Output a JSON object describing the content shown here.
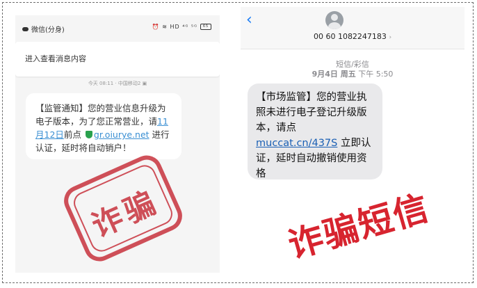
{
  "left": {
    "status": {
      "app": "微信(分身)",
      "icons": "⏰ ≋ HD ⁴ᴳ ⁵ᴳ",
      "battery": "65"
    },
    "notice": "进入查看消息内容",
    "time_line": "今天 08:11 · 中国移动2 ▣",
    "message": {
      "part1": "【监管通知】您的营业信息升级为电子版本，为了您正常营业，请",
      "date_link": "11月12日",
      "part2": "前点",
      "url": "gr.oiurye.net",
      "part3": " 进行认证，延时将自动销户！"
    },
    "stamp_text": "诈骗"
  },
  "right": {
    "back_icon": "‹",
    "sender": "00 60 1082247183",
    "sender_chevron": "›",
    "type": "短信/彩信",
    "date_bold": "9月4日 周五",
    "date_time": " 下午 5:50",
    "message": {
      "part1": "【市场监管】您的营业执照未进行电子登记升级版本，请点",
      "url": "muccat.cn/437S",
      "part2": " 立即认证，延时自动撤销使用资格"
    },
    "caption": "诈骗短信"
  },
  "colors": {
    "stamp_red": "#c62b36",
    "caption_red": "#d7242f",
    "ios_blue": "#1a7cf5",
    "link_blue": "#3a8fd3"
  }
}
